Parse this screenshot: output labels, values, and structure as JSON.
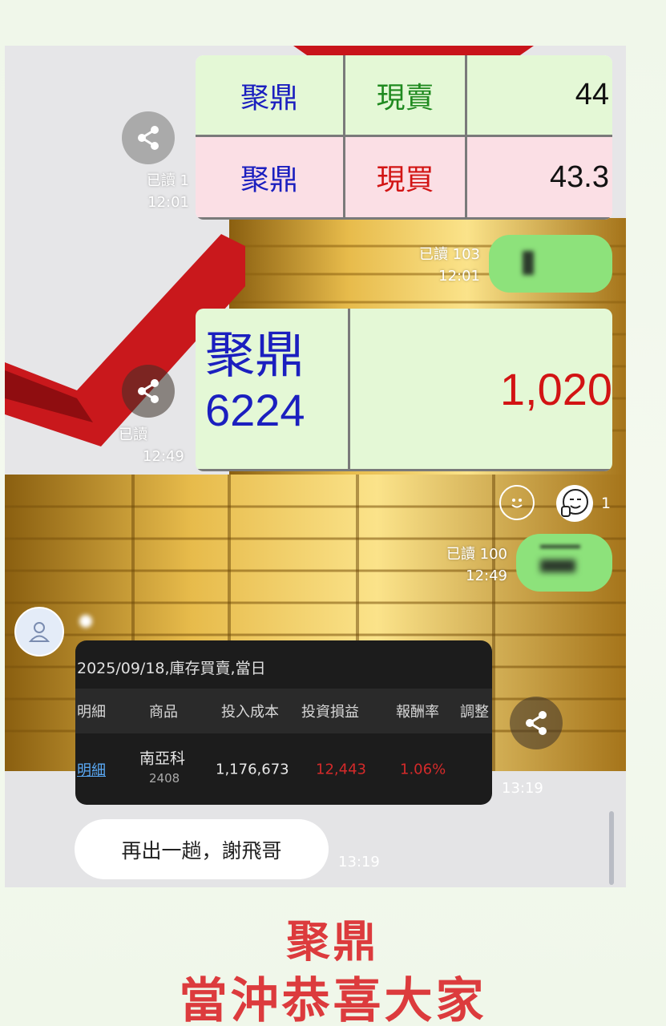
{
  "quote_card": {
    "rows": [
      {
        "name": "聚鼎",
        "side": "現賣",
        "price": "44"
      },
      {
        "name": "聚鼎",
        "side": "現買",
        "price": "43.3"
      }
    ]
  },
  "messages": {
    "read_1_label": "已讀 1",
    "time_1": "12:01",
    "read_2_label": "已讀 103",
    "time_2": "12:01",
    "read_3_label": "已讀",
    "time_3": "12:49",
    "read_4_label": "已讀 100",
    "time_4": "12:49",
    "reaction_count": "1",
    "time_5": "13:19",
    "time_6": "13:19",
    "reply_text": "再出一趟，謝飛哥"
  },
  "stock_card": {
    "name": "聚鼎",
    "code": "6224",
    "price": "1,020"
  },
  "trade_card": {
    "title": "2025/09/18,庫存買賣,當日",
    "headers": [
      "明細",
      "商品",
      "投入成本",
      "投資損益",
      "報酬率",
      "調整"
    ],
    "row": {
      "detail_link": "明細",
      "product": "南亞科",
      "product_code": "2408",
      "cost": "1,176,673",
      "pnl": "12,443",
      "rate": "1.06%"
    }
  },
  "caption": {
    "line1": "聚鼎",
    "line2": "當沖恭喜大家"
  },
  "colors": {
    "caption_red": "#dc3b3d",
    "bubble_green": "#8de27b",
    "name_blue": "#1b1fbf",
    "price_red": "#d21414"
  }
}
